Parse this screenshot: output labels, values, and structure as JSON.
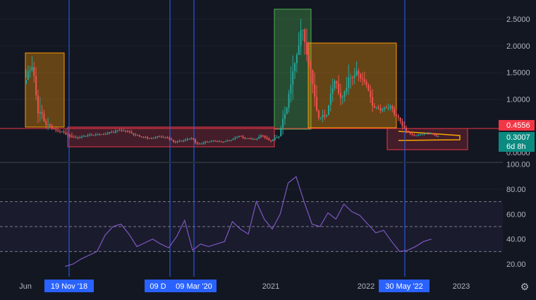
{
  "colors": {
    "background": "#131722",
    "grid": "#1e222d",
    "candle_up": "#26a69a",
    "candle_down": "#ef5350",
    "vertical_marker": "#2962ff",
    "rsi_line": "#7e57c2",
    "rsi_band": "rgba(126,87,194,0.07)",
    "orange_box": "rgba(255,152,0,0.35)",
    "green_box": "rgba(76,175,80,0.35)",
    "red_box": "rgba(242,54,69,0.22)",
    "price_label_red": "#f23645",
    "price_label_teal": "#0b8a80",
    "axis_text": "#b2b5be",
    "triangle": "#f7a600",
    "date_badge_bg": "#2962ff"
  },
  "price_axis": {
    "ticks": [
      "2.5000",
      "2.0000",
      "1.5000",
      "1.0000",
      "0.0000"
    ],
    "labels": {
      "last_high": "0.4556",
      "last_price": "0.3007",
      "countdown": "6d 8h"
    }
  },
  "rsi_axis": {
    "ticks": [
      "100.00",
      "80.00",
      "60.00",
      "40.00",
      "20.00"
    ],
    "upper_band": 70,
    "mid_line": 50,
    "lower_band": 30
  },
  "time_axis": {
    "labels": [
      "Jun",
      "2021",
      "2022",
      "2023"
    ],
    "highlighted": [
      "19 Nov '18",
      "09 D",
      "09 Mar '20",
      "30 May '22"
    ]
  },
  "chart_data": [
    {
      "type": "candlestick",
      "title": "",
      "x_labels": [
        "Jun",
        "2021",
        "2022",
        "2023"
      ],
      "y_ticks": [
        2.5,
        2.0,
        1.5,
        1.0,
        0.0
      ],
      "price_labels": [
        0.4556,
        0.3007
      ],
      "x": [
        "2018-06",
        "2018-07",
        "2018-08",
        "2018-09",
        "2018-10",
        "2018-11",
        "2018-12",
        "2019-01",
        "2019-02",
        "2019-03",
        "2019-04",
        "2019-05",
        "2019-06",
        "2019-07",
        "2019-08",
        "2019-09",
        "2019-10",
        "2019-11",
        "2019-12",
        "2020-01",
        "2020-02",
        "2020-03",
        "2020-04",
        "2020-05",
        "2020-06",
        "2020-07",
        "2020-08",
        "2020-09",
        "2020-10",
        "2020-11",
        "2020-12",
        "2021-01",
        "2021-02",
        "2021-03",
        "2021-04",
        "2021-05",
        "2021-06",
        "2021-07",
        "2021-08",
        "2021-09",
        "2021-10",
        "2021-11",
        "2021-12",
        "2022-01",
        "2022-02",
        "2022-03",
        "2022-04",
        "2022-05",
        "2022-06",
        "2022-07",
        "2022-08",
        "2022-09"
      ],
      "close": [
        1.6,
        0.7,
        0.5,
        0.42,
        0.38,
        0.3,
        0.28,
        0.32,
        0.33,
        0.34,
        0.38,
        0.42,
        0.4,
        0.33,
        0.28,
        0.26,
        0.3,
        0.28,
        0.2,
        0.22,
        0.26,
        0.15,
        0.2,
        0.22,
        0.2,
        0.23,
        0.3,
        0.26,
        0.25,
        0.32,
        0.22,
        0.3,
        0.8,
        1.6,
        2.3,
        1.6,
        0.7,
        0.7,
        1.3,
        1.0,
        1.4,
        1.5,
        1.3,
        0.85,
        0.8,
        0.85,
        0.65,
        0.42,
        0.32,
        0.34,
        0.36,
        0.3007
      ],
      "high": [
        2.2,
        1.7,
        0.9,
        0.55,
        0.48,
        0.45,
        0.36,
        0.38,
        0.4,
        0.4,
        0.48,
        0.5,
        0.45,
        0.42,
        0.33,
        0.32,
        0.35,
        0.33,
        0.3,
        0.28,
        0.32,
        0.27,
        0.26,
        0.27,
        0.26,
        0.3,
        0.35,
        0.33,
        0.3,
        0.38,
        0.33,
        0.45,
        1.0,
        2.2,
        2.55,
        2.35,
        1.6,
        1.0,
        1.5,
        1.6,
        2.0,
        1.85,
        1.6,
        1.35,
        1.0,
        1.0,
        0.9,
        0.65,
        0.38,
        0.38,
        0.4,
        0.36
      ],
      "low": [
        1.4,
        0.55,
        0.38,
        0.33,
        0.3,
        0.18,
        0.2,
        0.26,
        0.27,
        0.3,
        0.33,
        0.35,
        0.3,
        0.27,
        0.24,
        0.2,
        0.24,
        0.2,
        0.16,
        0.16,
        0.18,
        0.09,
        0.12,
        0.18,
        0.17,
        0.2,
        0.23,
        0.21,
        0.2,
        0.22,
        0.18,
        0.22,
        0.3,
        0.75,
        1.5,
        1.2,
        0.6,
        0.55,
        0.7,
        0.85,
        0.95,
        1.1,
        1.0,
        0.72,
        0.7,
        0.7,
        0.55,
        0.3,
        0.24,
        0.28,
        0.29,
        0.27
      ],
      "rsi": [
        null,
        null,
        null,
        null,
        null,
        18,
        20,
        24,
        27,
        30,
        43,
        50,
        52,
        44,
        34,
        37,
        40,
        36,
        33,
        42,
        55,
        31,
        36,
        34,
        36,
        38,
        54,
        48,
        44,
        70,
        56,
        48,
        60,
        85,
        90,
        70,
        52,
        50,
        61,
        56,
        68,
        62,
        59,
        52,
        45,
        47,
        38,
        30,
        31,
        34,
        38,
        40
      ],
      "annotations": [
        "19 Nov '18",
        "09 D",
        "09 Mar '20",
        "30 May '22"
      ],
      "ylim": [
        0,
        2.75
      ],
      "rsi_ylim": [
        10,
        100
      ]
    }
  ]
}
